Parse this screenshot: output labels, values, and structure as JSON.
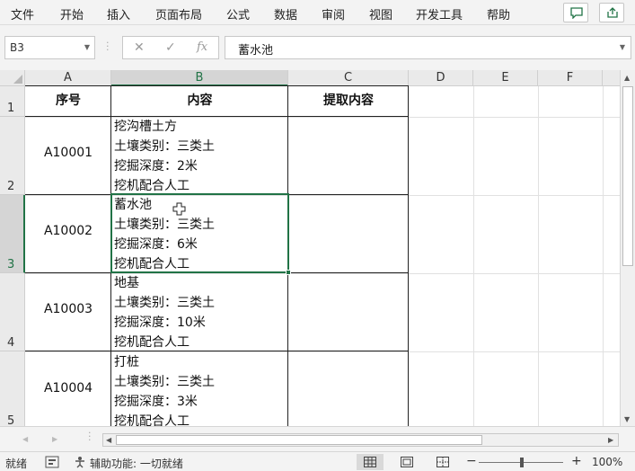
{
  "menu": {
    "items": [
      "文件",
      "开始",
      "插入",
      "页面布局",
      "公式",
      "数据",
      "审阅",
      "视图",
      "开发工具",
      "帮助"
    ]
  },
  "ribbon_icons": [
    "comment-icon",
    "share-icon"
  ],
  "formula_bar": {
    "name_box": "B3",
    "content": "蓄水池",
    "fx_label": "fx"
  },
  "columns": [
    "A",
    "B",
    "C",
    "D",
    "E",
    "F"
  ],
  "rows": [
    "1",
    "2",
    "3",
    "4",
    "5"
  ],
  "selected_cell": "B3",
  "table": {
    "headers": [
      "序号",
      "内容",
      "提取内容"
    ],
    "rows": [
      {
        "id": "A10001",
        "content": [
          "挖沟槽土方",
          "土壤类别：三类土",
          "挖掘深度：2米",
          "挖机配合人工"
        ],
        "extract": ""
      },
      {
        "id": "A10002",
        "content": [
          "蓄水池",
          "土壤类别：三类土",
          "挖掘深度：6米",
          "挖机配合人工"
        ],
        "extract": ""
      },
      {
        "id": "A10003",
        "content": [
          "地基",
          "土壤类别：三类土",
          "挖掘深度：10米",
          "挖机配合人工"
        ],
        "extract": ""
      },
      {
        "id": "A10004",
        "content": [
          "打桩",
          "土壤类别：三类土",
          "挖掘深度：3米",
          "挖机配合人工"
        ],
        "extract": ""
      }
    ]
  },
  "status": {
    "ready": "就绪",
    "accessibility": "辅助功能: 一切就绪",
    "zoom": "100%",
    "zoom_minus": "−",
    "zoom_plus": "+"
  },
  "colors": {
    "accent": "#217346"
  }
}
